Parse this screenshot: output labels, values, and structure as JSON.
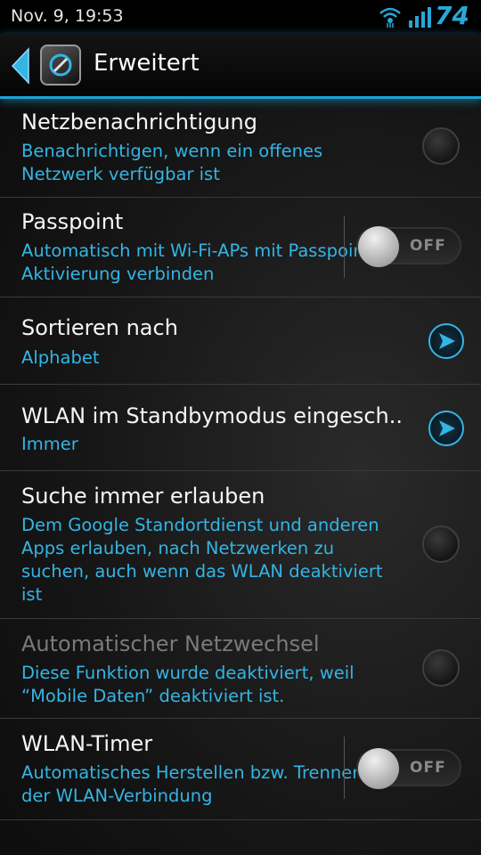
{
  "statusbar": {
    "time": "Nov. 9, 19:53",
    "battery": "74"
  },
  "actionbar": {
    "title": "Erweitert"
  },
  "items": [
    {
      "title": "Netzbenachrichtigung",
      "summary": "Benachrichtigen, wenn ein offenes Netzwerk verfügbar ist",
      "control": "checkbox"
    },
    {
      "title": "Passpoint",
      "summary": "Automatisch mit Wi-Fi-APs mit Passpoint-Aktivierung verbinden",
      "control": "toggle",
      "state": "OFF"
    },
    {
      "title": "Sortieren nach",
      "summary": "Alphabet",
      "control": "arrow"
    },
    {
      "title": "WLAN im Standbymodus eingesch..",
      "summary": "Immer",
      "control": "arrow"
    },
    {
      "title": "Suche immer erlauben",
      "summary": "Dem Google Standortdienst und anderen Apps erlauben, nach Netzwerken zu suchen, auch wenn das WLAN deaktiviert ist",
      "control": "checkbox"
    },
    {
      "title": "Automatischer Netzwechsel",
      "summary": "Diese Funktion wurde deaktiviert, weil “Mobile Daten” deaktiviert ist.",
      "control": "checkbox"
    },
    {
      "title": "WLAN-Timer",
      "summary": "Automatisches Herstellen bzw. Trennen der WLAN-Verbindung",
      "control": "toggle",
      "state": "OFF"
    }
  ]
}
